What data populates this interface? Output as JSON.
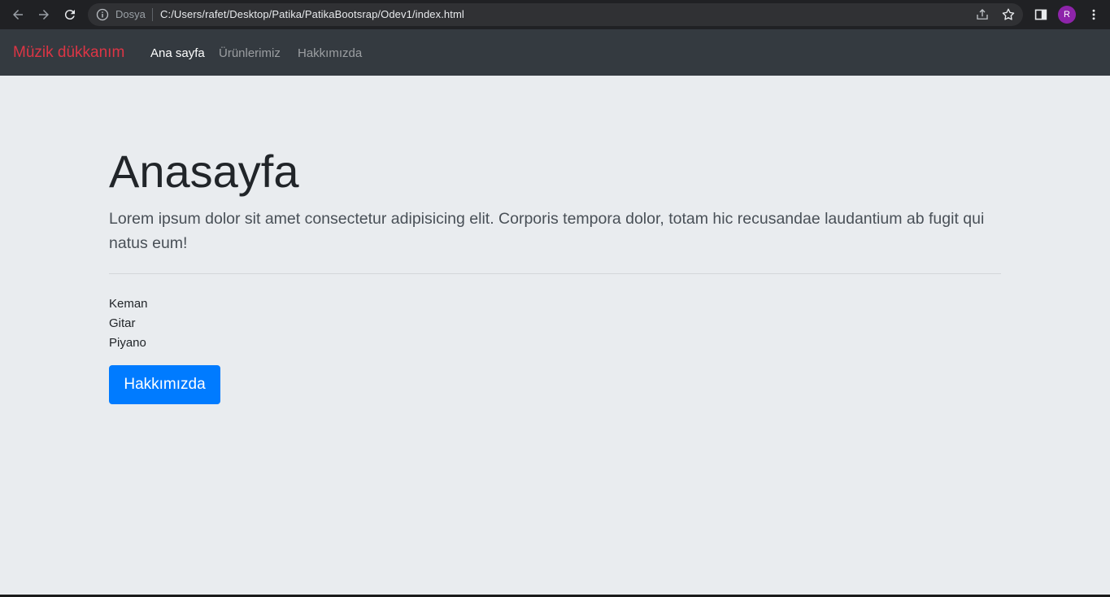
{
  "browser": {
    "file_label": "Dosya",
    "url": "C:/Users/rafet/Desktop/Patika/PatikaBootsrap/Odev1/index.html",
    "profile_initial": "R",
    "icons": [
      "back-icon",
      "forward-icon",
      "reload-icon",
      "info-icon",
      "share-icon",
      "star-icon",
      "side-panel-icon",
      "menu-icon"
    ]
  },
  "navbar": {
    "brand": "Müzik dükkanım",
    "links": [
      {
        "label": "Ana sayfa",
        "active": true
      },
      {
        "label": "Ürünlerimiz",
        "active": false
      },
      {
        "label": "Hakkımızda",
        "active": false
      }
    ]
  },
  "jumbotron": {
    "title": "Anasayfa",
    "lead": "Lorem ipsum dolor sit amet consectetur adipisicing elit. Corporis tempora dolor, totam hic recusandae laudantium ab fugit qui natus eum!",
    "items": [
      "Keman",
      "Gitar",
      "Piyano"
    ],
    "button_label": "Hakkımızda"
  },
  "colors": {
    "brand": "#dc3545",
    "navbar_bg": "#343a40",
    "page_bg": "#e9ecef",
    "button_bg": "#007bff",
    "profile_bg": "#8e24aa"
  }
}
